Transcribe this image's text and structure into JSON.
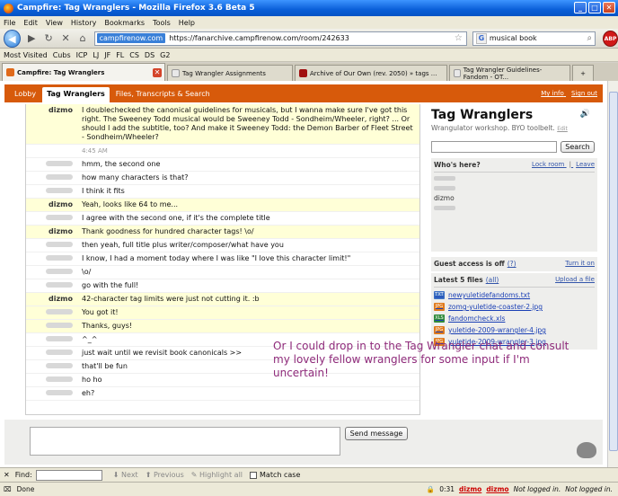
{
  "window": {
    "title": "Campfire: Tag Wranglers - Mozilla Firefox 3.6 Beta 5"
  },
  "menu": [
    "File",
    "Edit",
    "View",
    "History",
    "Bookmarks",
    "Tools",
    "Help"
  ],
  "nav": {
    "site_badge": "campfirenow.com",
    "url": "https://fanarchive.campfirenow.com/room/242633",
    "search_value": "musical book"
  },
  "bookmarks": [
    "Most Visited",
    "Cubs",
    "ICP",
    "LJ",
    "JF",
    "FL",
    "CS",
    "DS",
    "G2"
  ],
  "tabs": [
    "Campfire: Tag Wranglers",
    "Tag Wrangler Assignments",
    "Archive of Our Own (rev. 2050) » tags ...",
    "Tag Wrangler Guidelines-Fandom - OT..."
  ],
  "campfire_nav": {
    "tabs": [
      "Lobby",
      "Tag Wranglers",
      "Files, Transcripts & Search"
    ],
    "my_info": "My info",
    "sign_out": "Sign out"
  },
  "messages": [
    {
      "who": "dizmo",
      "text": "I doublechecked the canonical guidelines for musicals, but I wanna make sure I've got this right. The Sweeney Todd musical would be Sweeney Todd - Sondheim/Wheeler, right? ... Or should I add the subtitle, too? And make it Sweeney Todd: the Demon Barber of Fleet Street - Sondheim/Wheeler?",
      "hl": true
    },
    {
      "who": "",
      "text": "4:45 AM",
      "ts": true
    },
    {
      "who": "",
      "text": "hmm, the second one"
    },
    {
      "who": "",
      "text": "how many characters is that?"
    },
    {
      "who": "",
      "text": "I think it fits"
    },
    {
      "who": "dizmo",
      "text": "Yeah, looks like 64 to me...",
      "hl": true
    },
    {
      "who": "",
      "text": "I agree with the second one, if it's the complete title"
    },
    {
      "who": "dizmo",
      "text": "Thank goodness for hundred character tags! \\o/",
      "hl": true
    },
    {
      "who": "",
      "text": "then yeah, full title plus writer/composer/what have you"
    },
    {
      "who": "",
      "text": "I know, I had a moment today where I was like \"I love this character limit!\""
    },
    {
      "who": "",
      "text": "\\o/"
    },
    {
      "who": "",
      "text": "go with the full!"
    },
    {
      "who": "dizmo",
      "text": "42-character tag limits were just not cutting it. :b",
      "hl": true
    },
    {
      "who": "",
      "text": "You got it!",
      "hl": true
    },
    {
      "who": "",
      "text": "Thanks, guys!",
      "hl": true
    },
    {
      "who": "",
      "text": "^_^"
    },
    {
      "who": "",
      "text": "just wait until we revisit book canonicals >>"
    },
    {
      "who": "",
      "text": "that'll be fun"
    },
    {
      "who": "",
      "text": "ho ho"
    },
    {
      "who": "",
      "text": "eh?"
    }
  ],
  "composer": {
    "send": "Send message"
  },
  "sidebar": {
    "room_name": "Tag Wranglers",
    "topic": "Wrangulator workshop. BYO toolbelt.",
    "edit": "Edit",
    "search_button": "Search",
    "whos_here": "Who's here?",
    "lock_room": "Lock room",
    "leave": "Leave",
    "present_user": "dizmo",
    "guest_access": "Guest access is off",
    "guest_help": "(?)",
    "turn_on": "Turn it on",
    "latest_files": "Latest 5 files",
    "all": "(all)",
    "upload": "Upload a file",
    "files": [
      {
        "name": "newyuletidefandoms.txt",
        "type": "TXT",
        "color": "#3b6fc2"
      },
      {
        "name": "zomg-yuletide-coaster-2.jpg",
        "type": "JPG",
        "color": "#e07a1b"
      },
      {
        "name": "fandomcheck.xls",
        "type": "XLS",
        "color": "#2f8a3a"
      },
      {
        "name": "yuletide-2009-wrangler-4.jpg",
        "type": "JPG",
        "color": "#e07a1b"
      },
      {
        "name": "yuletide-2009-wrangler-3.jpg",
        "type": "JPG",
        "color": "#e07a1b"
      }
    ]
  },
  "overlay_note": "Or I could drop in to the Tag Wrangler chat and consult my lovely fellow wranglers for some input if I'm uncertain!",
  "findbar": {
    "label": "Find:",
    "next": "Next",
    "previous": "Previous",
    "highlight": "Highlight all",
    "match_case": "Match case"
  },
  "status": {
    "text": "Done",
    "time": "0:31",
    "user1": "dizmo",
    "user2": "dizmo",
    "notlogged1": "Not logged in.",
    "notlogged2": "Not logged in."
  }
}
